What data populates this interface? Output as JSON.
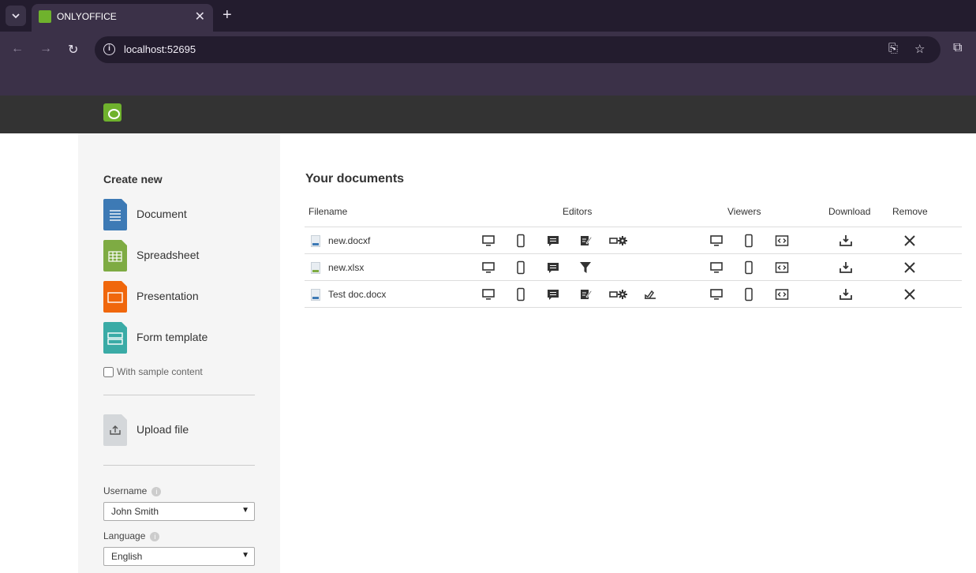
{
  "browser": {
    "tab_title": "ONLYOFFICE",
    "url": "localhost:52695"
  },
  "sidebar": {
    "create_title": "Create new",
    "items": [
      {
        "label": "Document",
        "color": "#3d7ab5"
      },
      {
        "label": "Spreadsheet",
        "color": "#7eab43"
      },
      {
        "label": "Presentation",
        "color": "#f0670c"
      },
      {
        "label": "Form template",
        "color": "#3aaba6"
      }
    ],
    "sample_label": "With sample content",
    "upload_label": "Upload file",
    "username_label": "Username",
    "username_value": "John Smith",
    "language_label": "Language",
    "language_value": "English"
  },
  "main": {
    "title": "Your documents",
    "columns": {
      "filename": "Filename",
      "editors": "Editors",
      "viewers": "Viewers",
      "download": "Download",
      "remove": "Remove"
    },
    "files": [
      {
        "name": "new.docxf",
        "type_color": "#3d7ab5",
        "editors": [
          "desktop-icon",
          "mobile-icon",
          "comment-icon",
          "review-icon",
          "fill-forms-icon"
        ]
      },
      {
        "name": "new.xlsx",
        "type_color": "#7eab43",
        "editors": [
          "desktop-icon",
          "mobile-icon",
          "comment-icon",
          "filter-icon"
        ]
      },
      {
        "name": "Test doc.docx",
        "type_color": "#3d7ab5",
        "editors": [
          "desktop-icon",
          "mobile-icon",
          "comment-icon",
          "review-icon",
          "fill-forms-icon",
          "signature-icon"
        ]
      }
    ],
    "viewers": [
      "desktop-view-icon",
      "mobile-view-icon",
      "embedded-icon"
    ]
  }
}
